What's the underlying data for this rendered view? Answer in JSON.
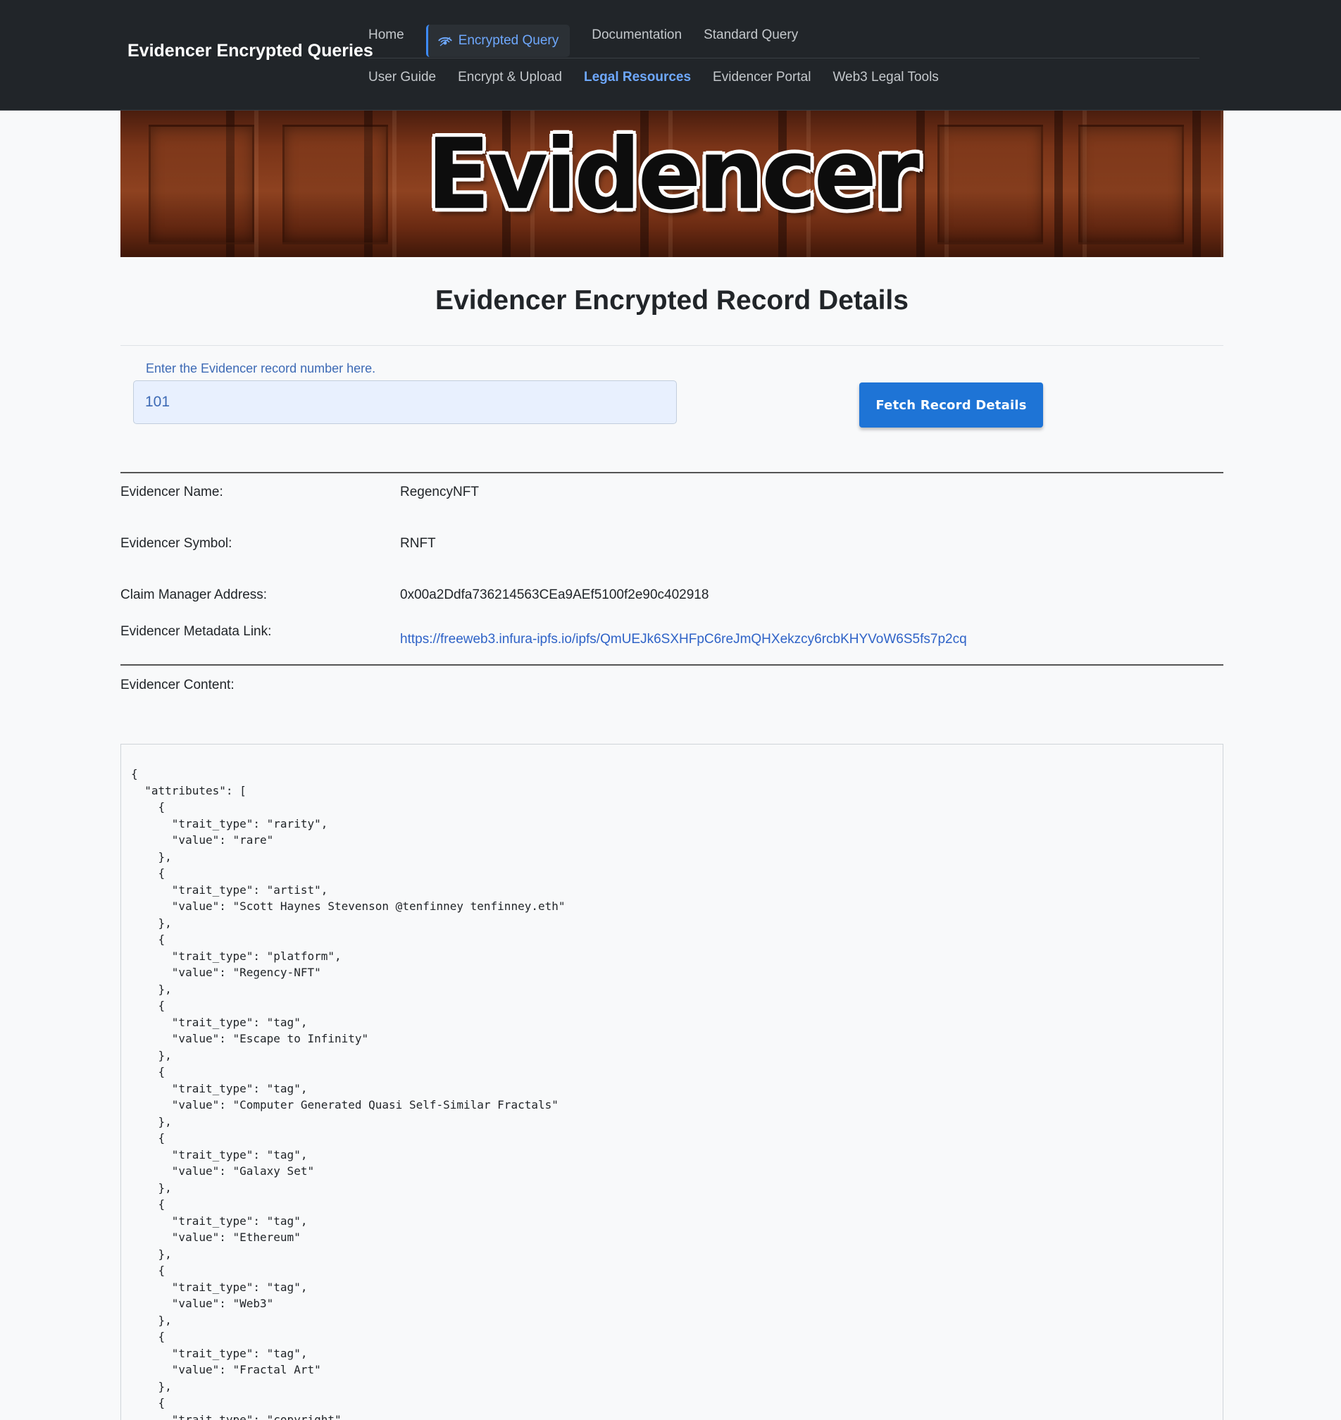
{
  "navbar": {
    "brand": "Evidencer Encrypted Queries",
    "row1": [
      {
        "label": "Home"
      },
      {
        "label": "Encrypted Query",
        "active": true
      },
      {
        "label": "Documentation"
      },
      {
        "label": "Standard Query"
      }
    ],
    "row2": [
      {
        "label": "User Guide"
      },
      {
        "label": "Encrypt & Upload"
      },
      {
        "label": "Legal Resources",
        "highlight": true
      },
      {
        "label": "Evidencer Portal"
      },
      {
        "label": "Web3 Legal Tools"
      }
    ],
    "active_icon": "eye-icon",
    "accent_color": "#6ea8fe"
  },
  "banner": {
    "logo_text": "Evidencer"
  },
  "page": {
    "title": "Evidencer Encrypted Record Details"
  },
  "form": {
    "label": "Enter the Evidencer record number here.",
    "value": "101",
    "button_label": "Fetch Record Details",
    "button_color": "#1e74d6"
  },
  "details": {
    "name_label": "Evidencer Name:",
    "name_value": "RegencyNFT",
    "symbol_label": "Evidencer Symbol:",
    "symbol_value": "RNFT",
    "claim_label": "Claim Manager Address:",
    "claim_value": "0x00a2Ddfa736214563CEa9AEf5100f2e90c402918",
    "metadata_label": "Evidencer Metadata Link:",
    "metadata_value": "https://freeweb3.infura-ipfs.io/ipfs/QmUEJk6SXHFpC6reJmQHXekzcy6rcbKHYVoW6S5fs7p2cq",
    "content_label": "Evidencer Content:"
  },
  "content": {
    "json_text": "{\n  \"attributes\": [\n    {\n      \"trait_type\": \"rarity\",\n      \"value\": \"rare\"\n    },\n    {\n      \"trait_type\": \"artist\",\n      \"value\": \"Scott Haynes Stevenson @tenfinney tenfinney.eth\"\n    },\n    {\n      \"trait_type\": \"platform\",\n      \"value\": \"Regency-NFT\"\n    },\n    {\n      \"trait_type\": \"tag\",\n      \"value\": \"Escape to Infinity\"\n    },\n    {\n      \"trait_type\": \"tag\",\n      \"value\": \"Computer Generated Quasi Self-Similar Fractals\"\n    },\n    {\n      \"trait_type\": \"tag\",\n      \"value\": \"Galaxy Set\"\n    },\n    {\n      \"trait_type\": \"tag\",\n      \"value\": \"Ethereum\"\n    },\n    {\n      \"trait_type\": \"tag\",\n      \"value\": \"Web3\"\n    },\n    {\n      \"trait_type\": \"tag\",\n      \"value\": \"Fractal Art\"\n    },\n    {\n      \"trait_type\": \"copyright\","
  }
}
